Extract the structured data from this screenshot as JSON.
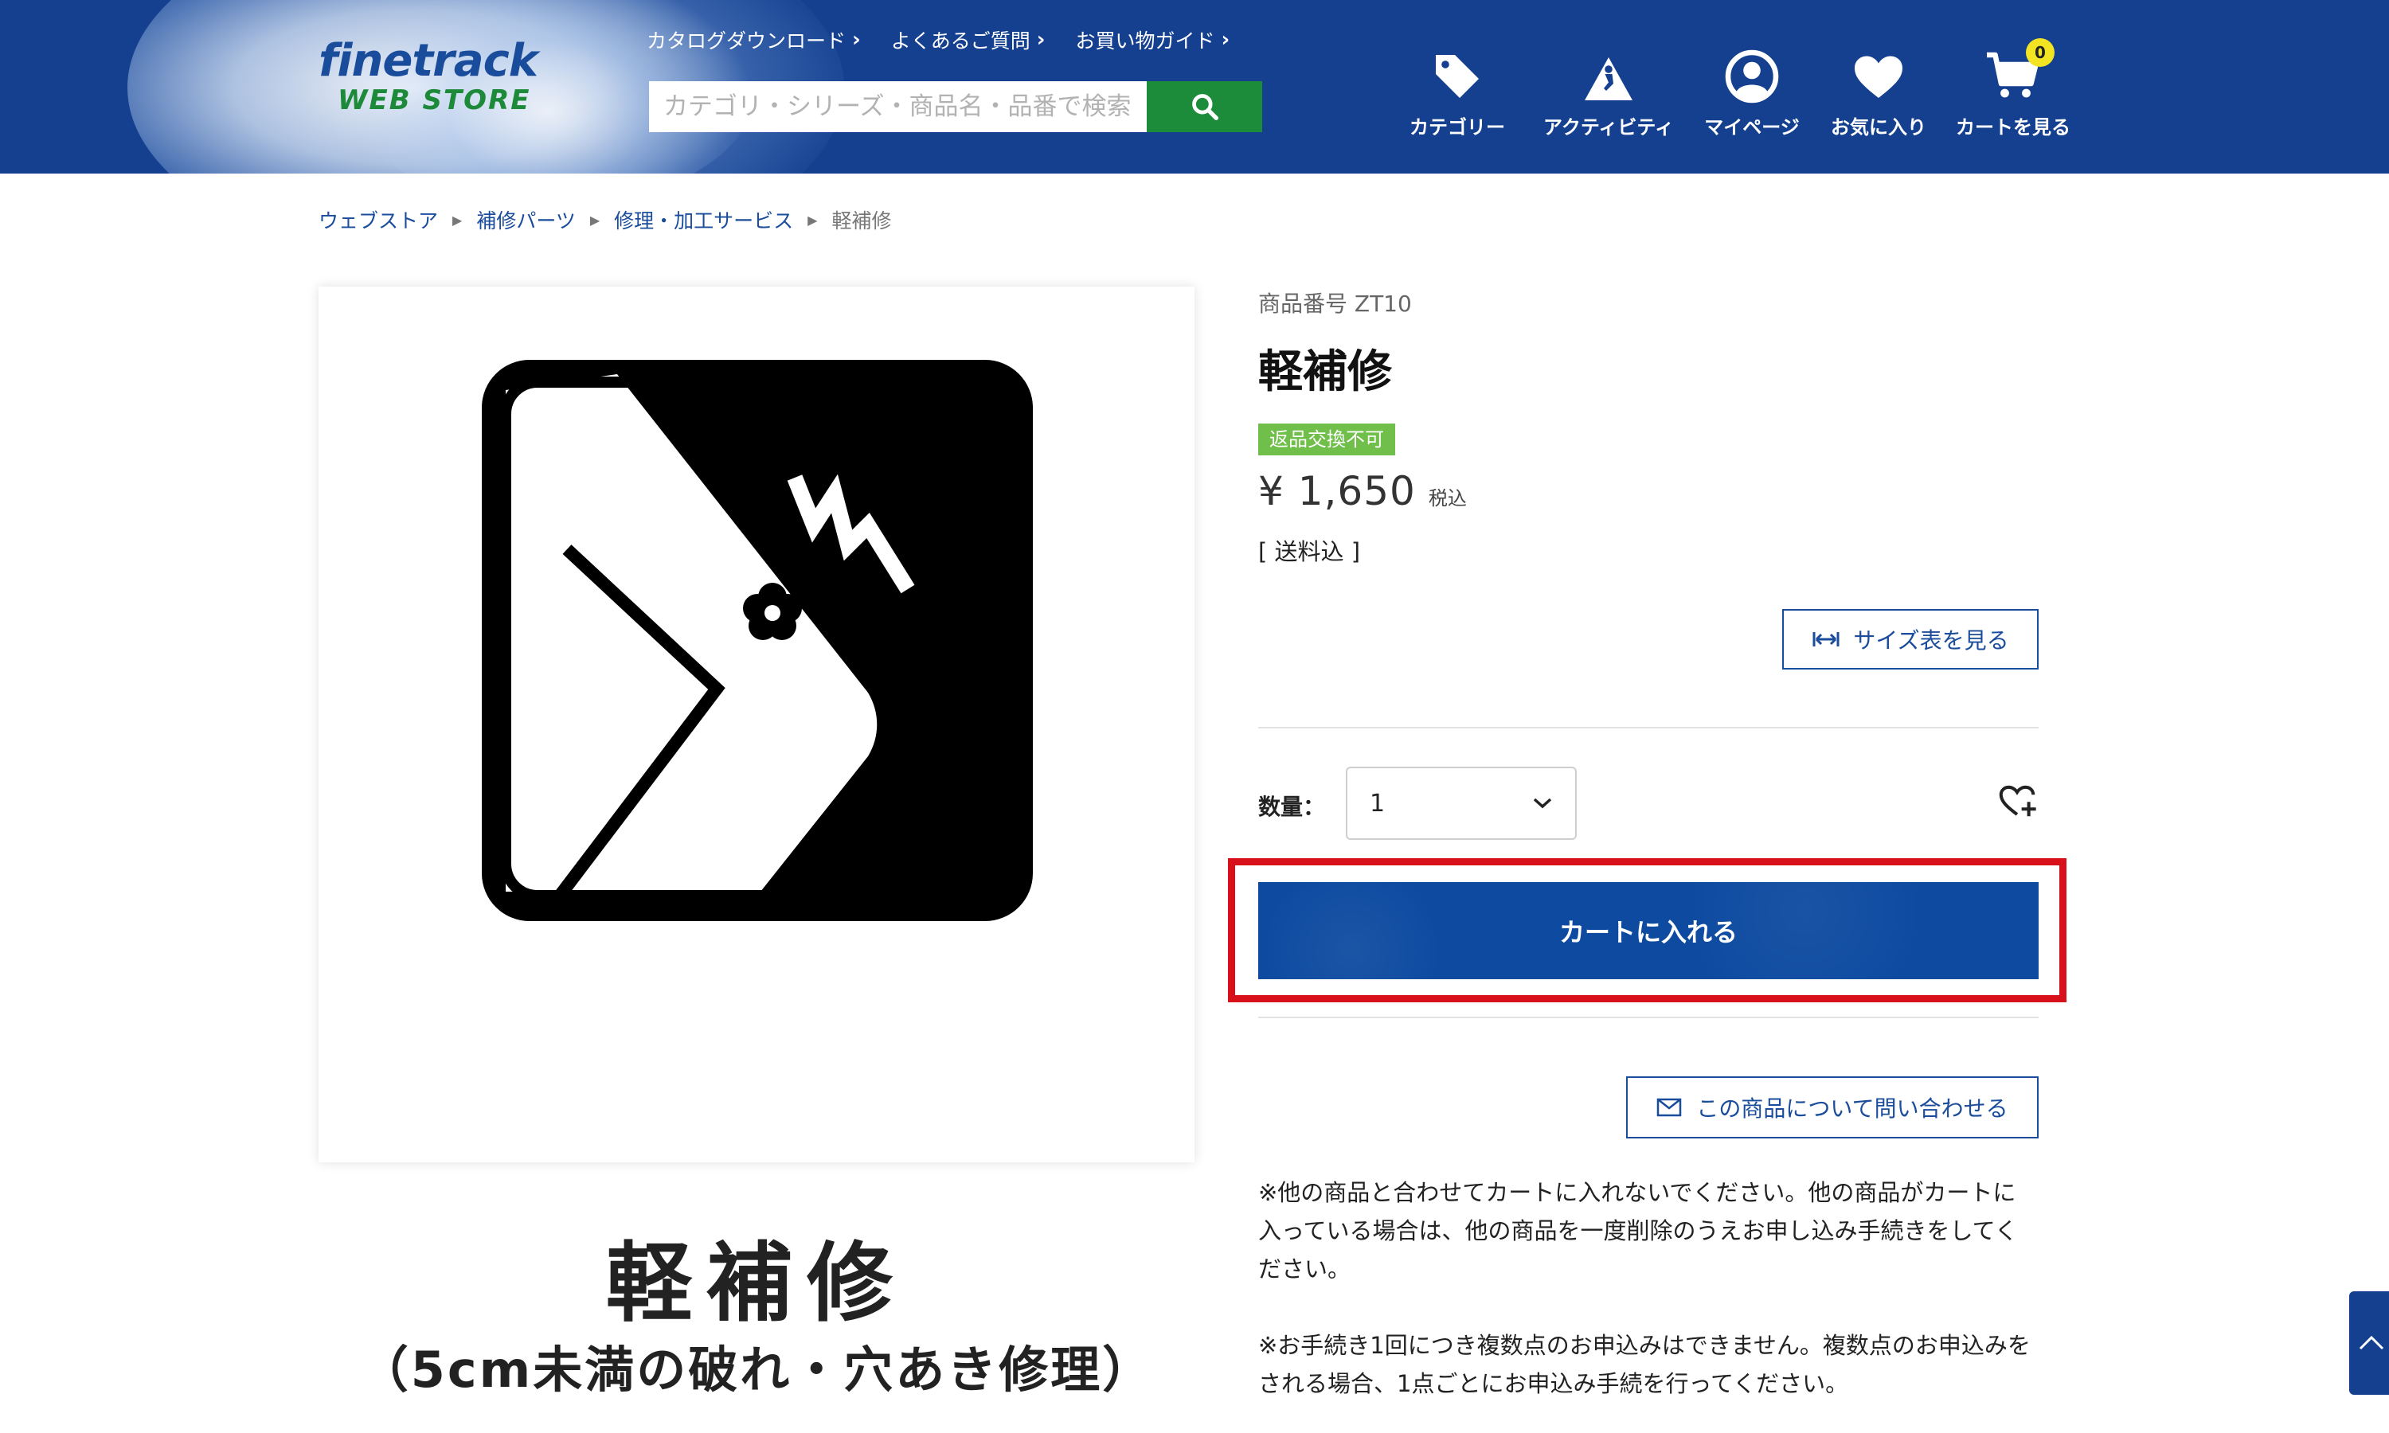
{
  "header": {
    "logo": {
      "main": "finetrack",
      "sub": "WEB STORE"
    },
    "top_links": [
      {
        "label": "カタログダウンロード"
      },
      {
        "label": "よくあるご質問"
      },
      {
        "label": "お買い物ガイド"
      }
    ],
    "search": {
      "placeholder": "カテゴリ・シリーズ・商品名・品番で検索"
    },
    "nav": [
      {
        "label": "カテゴリー",
        "icon": "tag-icon"
      },
      {
        "label": "アクティビティ",
        "icon": "climber-icon"
      },
      {
        "label": "マイページ",
        "icon": "user-icon"
      },
      {
        "label": "お気に入り",
        "icon": "heart-icon"
      },
      {
        "label": "カートを見る",
        "icon": "cart-icon"
      }
    ],
    "cart_count": "0"
  },
  "breadcrumb": [
    {
      "label": "ウェブストア"
    },
    {
      "label": "補修パーツ"
    },
    {
      "label": "修理・加工サービス"
    },
    {
      "label": "軽補修"
    }
  ],
  "product_image": {
    "title": "軽補修",
    "subtitle": "（5cm未満の破れ・穴あき修理）"
  },
  "product": {
    "sku": "商品番号 ZT10",
    "title": "軽補修",
    "badge": "返品交換不可",
    "price": "¥ 1,650",
    "tax_label": "税込",
    "shipping": "[ 送料込 ]",
    "size_chart_label": "サイズ表を見る",
    "quantity_label": "数量：",
    "quantity_value": "1",
    "add_to_cart_label": "カートに入れる",
    "contact_label": "この商品について問い合わせる",
    "notes": [
      "※他の商品と合わせてカートに入れないでください。他の商品がカートに入っている場合は、他の商品を一度削除のうえお申し込み手続きをしてください。",
      "※お手続き1回につき複数点のお申込みはできません。複数点のお申込みをされる場合、1点ごとにお申込み手続を行ってください。"
    ]
  },
  "colors": {
    "header_bg": "#14408f",
    "search_button": "#1c8c3a",
    "cart_button": "#0d4aa0",
    "badge": "#6fbf4a",
    "highlight": "#d8101a",
    "link": "#1a4c9c"
  }
}
